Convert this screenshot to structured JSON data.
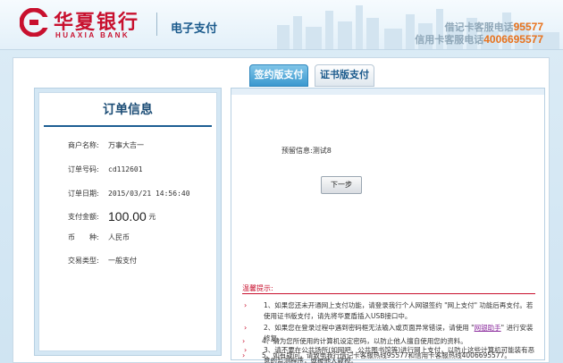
{
  "header": {
    "brand_cn": "华夏银行",
    "brand_en": "HUAXIA BANK",
    "subtitle": "电子支付",
    "debit_hotline_label": "借记卡客服电话",
    "debit_hotline_number": "95577",
    "credit_hotline_label": "信用卡客服电话",
    "credit_hotline_number": "4006695577"
  },
  "tabs": {
    "active_label": "签约版支付",
    "inactive_label": "证书版支付"
  },
  "order": {
    "title": "订单信息",
    "merchant_label": "商户名称:",
    "merchant_value": "万事大吉一",
    "order_no_label": "订单号码:",
    "order_no_value": "cd112601",
    "order_date_label": "订单日期:",
    "order_date_value": "2015/03/21 14:56:40",
    "amount_label": "支付金额:",
    "amount_value": "100.00",
    "amount_unit": "元",
    "currency_label": "币　　种:",
    "currency_value": "人民币",
    "txn_type_label": "交易类型:",
    "txn_type_value": "一般支付"
  },
  "payment": {
    "reserved_info_label": "预留信息:",
    "reserved_info_value": "测试8",
    "next_button": "下一步"
  },
  "tips": {
    "title": "温馨提示:",
    "items": [
      "1、如果您还未开通网上支付功能，请登录我行个人网银签约 \"网上支付\" 功能后再支付。若使用证书版支付，请先将华夏盾插入USB接口中。",
      "2、如果您在登录过程中遇到密码框无法输入或页面异常错误，请使用 \"",
      "3、请不要在公共场所(如网吧、公共图书馆等)进行网上支付，以防止这些计算机可能装有恶意的监测程序，或被他人窥视。",
      "4、请为您所使用的计算机设定密码，以防止他人擅自使用您的资料。",
      "5、如有疑问，请致电我行借记卡客服热线95577和信用卡客服热线4006695577。"
    ],
    "tip2_link": "网银助手",
    "tip2_tail": "\" 进行安装修复。"
  },
  "colors": {
    "brand_red": "#c8102e",
    "navy": "#1c4d76",
    "orange": "#e8721c",
    "tab_blue": "#3a98cf"
  }
}
